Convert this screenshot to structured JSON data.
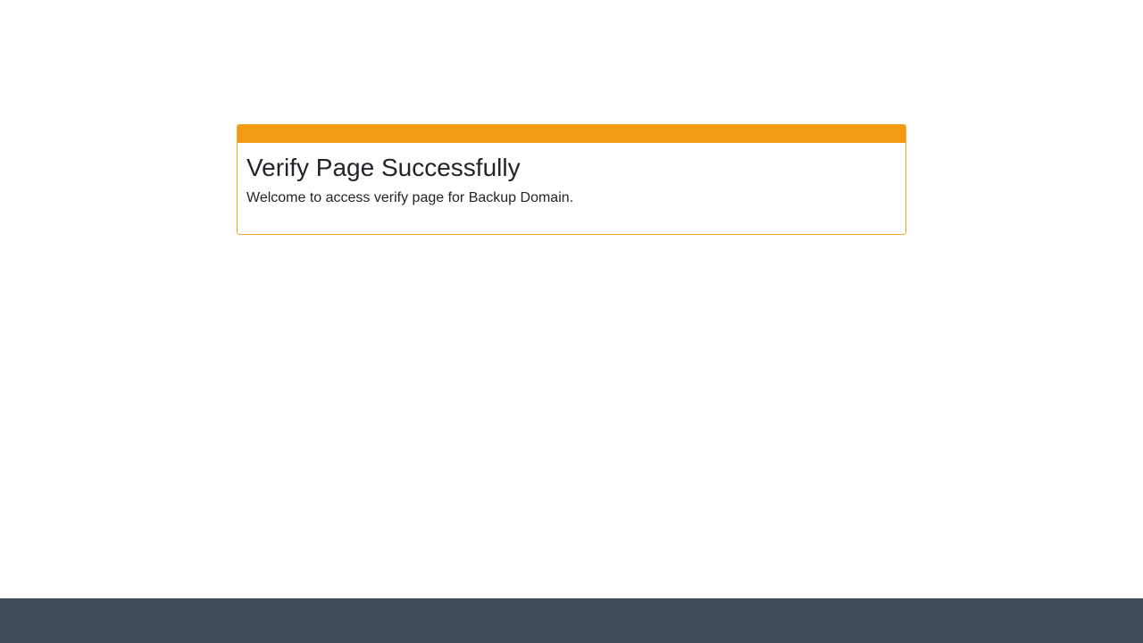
{
  "card": {
    "title": "Verify Page Successfully",
    "message": "Welcome to access verify page for Backup Domain."
  },
  "colors": {
    "accent": "#f39c12",
    "footer": "#424b5b",
    "text": "#212529"
  }
}
